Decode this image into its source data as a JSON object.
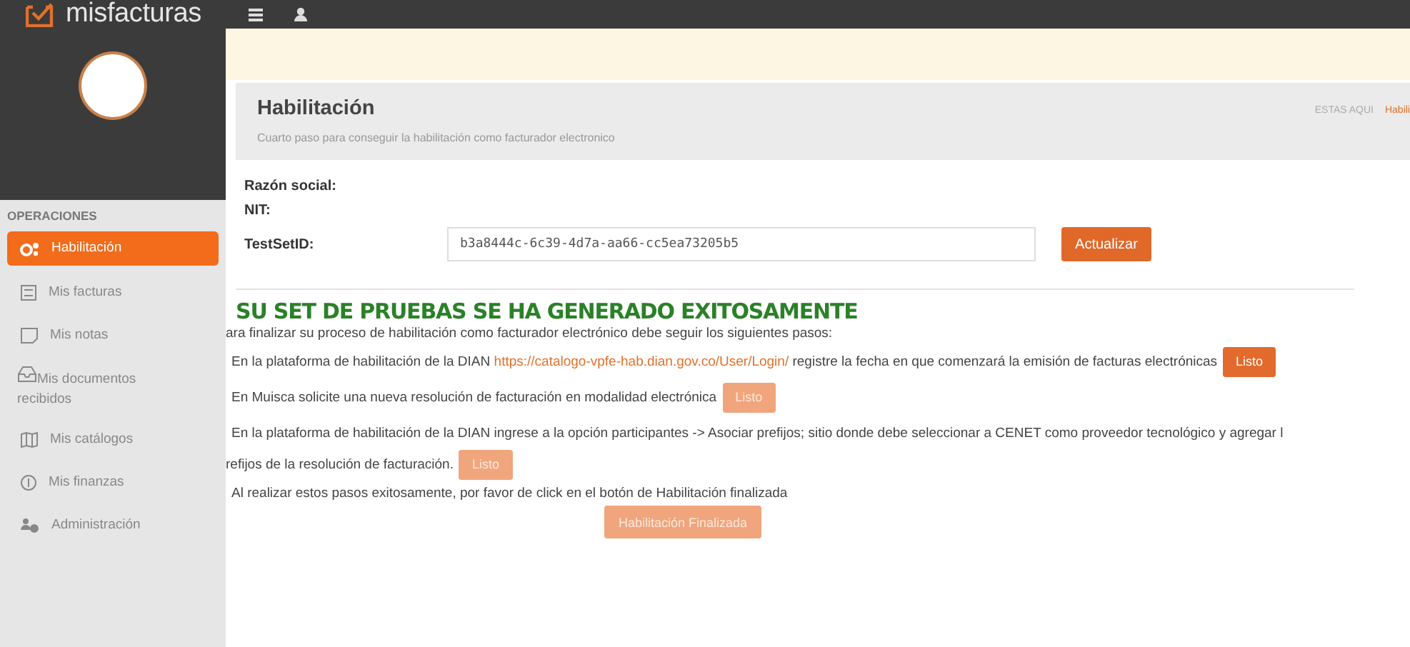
{
  "topbar": {
    "logo": "misfacturas"
  },
  "sidebar": {
    "section": "OPERACIONES",
    "items": [
      {
        "label": "Habilitación",
        "selected": true
      },
      {
        "label": "Mis facturas",
        "selected": false
      },
      {
        "label": "Mis notas",
        "selected": false
      },
      {
        "label": "Mis documentos recibidos",
        "selected": false
      },
      {
        "label": "Mis catálogos",
        "selected": false
      },
      {
        "label": "Mis finanzas",
        "selected": false
      },
      {
        "label": "Administración",
        "selected": false
      }
    ]
  },
  "header": {
    "title": "Habilitación",
    "subtitle": "Cuarto paso para conseguir la habilitación como facturador electronico",
    "breadcrumb_label": "ESTAS AQUI",
    "breadcrumb_current": "Habili"
  },
  "form": {
    "fields": [
      {
        "label": "Razón social:",
        "kind": "text"
      },
      {
        "label": "NIT:",
        "kind": "text"
      },
      {
        "label": "TestSetID:",
        "kind": "input",
        "value": "b3a8444c-6c39-4d7a-aa66-cc5ea73205b5"
      }
    ],
    "button": "Actualizar"
  },
  "result": {
    "heading": "SU SET DE PRUEBAS SE HA GENERADO EXITOSAMENTE",
    "intro": "ara finalizar su proceso de habilitación como facturador electrónico debe seguir los siguientes pasos:",
    "steps": [
      {
        "lines": [
          "En la plataforma de habilitación de la DIAN **https://catalogo-vpfe-hab.dian.gov.co/User/Login/** registre la fecha en que comenzará la emisión de facturas electrónicas"
        ],
        "button": {
          "label": "Listo",
          "disabled": false
        }
      },
      {
        "lines": [
          "En Muisca solicite una nueva resolución de facturación en modalidad electrónica"
        ],
        "button": {
          "label": "Listo",
          "disabled": true
        }
      },
      {
        "lines": [
          "En la plataforma de habilitación de la DIAN ingrese a la opción participantes -> Asociar prefijos; sitio donde debe seleccionar a CENET como proveedor tecnológico y agregar l",
          "refijos de la resolución de facturación."
        ],
        "button": {
          "label": "Listo",
          "disabled": true
        }
      }
    ],
    "closing": "Al realizar estos pasos exitosamente, por favor de click en el botón de Habilitación finalizada",
    "final_button": {
      "label": "Habilitación Finalizada",
      "disabled": true
    }
  }
}
